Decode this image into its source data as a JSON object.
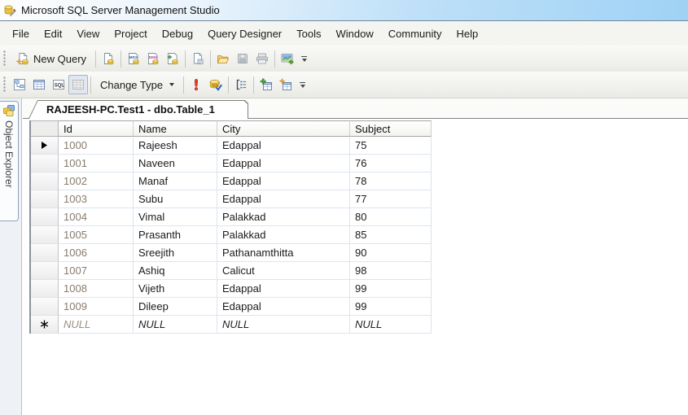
{
  "window": {
    "title": "Microsoft SQL Server Management Studio"
  },
  "menu": {
    "items": [
      "File",
      "Edit",
      "View",
      "Project",
      "Debug",
      "Query Designer",
      "Tools",
      "Window",
      "Community",
      "Help"
    ]
  },
  "standard_toolbar": {
    "new_query_label": "New Query",
    "icons": [
      "new-query-icon",
      "database-engine-query-icon",
      "analysis-services-mdx-query-icon",
      "analysis-services-dmx-query-icon",
      "analysis-services-xmla-query-icon",
      "sql-ce-query-icon",
      "open-file-icon",
      "save-icon",
      "print-icon",
      "activity-monitor-icon",
      "toolbar-options-icon"
    ],
    "disabled_icons": [
      "save-icon",
      "print-icon"
    ]
  },
  "query_designer_toolbar": {
    "change_type_label": "Change Type",
    "icons": [
      "show-diagram-pane-icon",
      "show-criteria-pane-icon",
      "show-sql-pane-icon",
      "show-results-pane-icon",
      "execute-sql-icon",
      "verify-sql-icon",
      "add-group-by-icon",
      "add-table-icon",
      "add-new-derived-table-icon",
      "toolbar-options-icon"
    ],
    "pressed_icons": [
      "show-results-pane-icon"
    ]
  },
  "sidebar": {
    "object_explorer_label": "Object Explorer"
  },
  "document": {
    "tab_title": "RAJEESH-PC.Test1 - dbo.Table_1"
  },
  "grid": {
    "columns": [
      "Id",
      "Name",
      "City",
      "Subject"
    ],
    "rows": [
      {
        "id": "1000",
        "name": "Rajeesh",
        "city": "Edappal",
        "subject": "75"
      },
      {
        "id": "1001",
        "name": "Naveen",
        "city": "Edappal",
        "subject": "76"
      },
      {
        "id": "1002",
        "name": "Manaf",
        "city": "Edappal",
        "subject": "78"
      },
      {
        "id": "1003",
        "name": "Subu",
        "city": "Edappal",
        "subject": "77"
      },
      {
        "id": "1004",
        "name": "Vimal",
        "city": "Palakkad",
        "subject": "80"
      },
      {
        "id": "1005",
        "name": "Prasanth",
        "city": "Palakkad",
        "subject": "85"
      },
      {
        "id": "1006",
        "name": "Sreejith",
        "city": "Pathanamthitta",
        "subject": "90"
      },
      {
        "id": "1007",
        "name": "Ashiq",
        "city": "Calicut",
        "subject": "98"
      },
      {
        "id": "1008",
        "name": "Vijeth",
        "city": "Edappal",
        "subject": "99"
      },
      {
        "id": "1009",
        "name": "Dileep",
        "city": "Edappal",
        "subject": "99"
      }
    ],
    "new_row": {
      "id": "NULL",
      "name": "NULL",
      "city": "NULL",
      "subject": "NULL"
    },
    "current_row_index": 0
  },
  "colors": {
    "titlebar_blue": "#a7d6f6",
    "id_text": "#877c6c",
    "gridline": "#dce5f0",
    "pressed_button_bg": "#e1e7f0"
  }
}
